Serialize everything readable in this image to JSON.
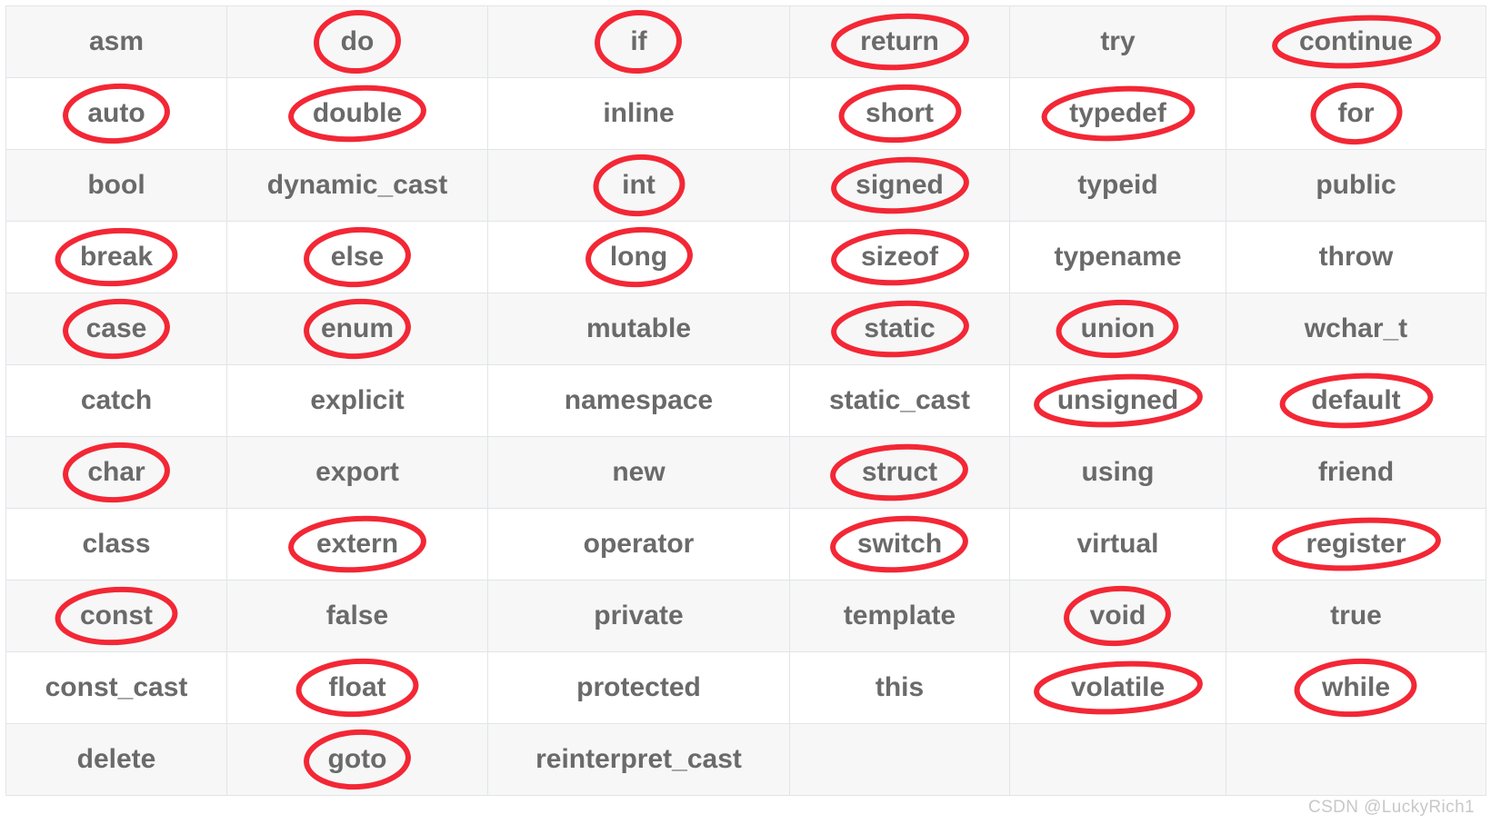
{
  "title": "C++ Keywords Table",
  "colors": {
    "annotation": "#f32735",
    "text": "#6a6a6a",
    "grid": "#e1e4e8",
    "stripe_background": "#f7f7f7",
    "plain_background": "#ffffff",
    "watermark": "#c8c8c8"
  },
  "watermark": "CSDN @LuckyRich1",
  "table": {
    "columns": 6,
    "rows": 11,
    "cells": [
      [
        {
          "text": "asm",
          "circled": false
        },
        {
          "text": "do",
          "circled": true
        },
        {
          "text": "if",
          "circled": true
        },
        {
          "text": "return",
          "circled": true
        },
        {
          "text": "try",
          "circled": false
        },
        {
          "text": "continue",
          "circled": true
        }
      ],
      [
        {
          "text": "auto",
          "circled": true
        },
        {
          "text": "double",
          "circled": true
        },
        {
          "text": "inline",
          "circled": false
        },
        {
          "text": "short",
          "circled": true
        },
        {
          "text": "typedef",
          "circled": true
        },
        {
          "text": "for",
          "circled": true
        }
      ],
      [
        {
          "text": "bool",
          "circled": false
        },
        {
          "text": "dynamic_cast",
          "circled": false
        },
        {
          "text": "int",
          "circled": true
        },
        {
          "text": "signed",
          "circled": true
        },
        {
          "text": "typeid",
          "circled": false
        },
        {
          "text": "public",
          "circled": false
        }
      ],
      [
        {
          "text": "break",
          "circled": true
        },
        {
          "text": "else",
          "circled": true
        },
        {
          "text": "long",
          "circled": true
        },
        {
          "text": "sizeof",
          "circled": true
        },
        {
          "text": "typename",
          "circled": false
        },
        {
          "text": "throw",
          "circled": false
        }
      ],
      [
        {
          "text": "case",
          "circled": true
        },
        {
          "text": "enum",
          "circled": true
        },
        {
          "text": "mutable",
          "circled": false
        },
        {
          "text": "static",
          "circled": true
        },
        {
          "text": "union",
          "circled": true
        },
        {
          "text": "wchar_t",
          "circled": false
        }
      ],
      [
        {
          "text": "catch",
          "circled": false
        },
        {
          "text": "explicit",
          "circled": false
        },
        {
          "text": "namespace",
          "circled": false
        },
        {
          "text": "static_cast",
          "circled": false
        },
        {
          "text": "unsigned",
          "circled": true
        },
        {
          "text": "default",
          "circled": true
        }
      ],
      [
        {
          "text": "char",
          "circled": true
        },
        {
          "text": "export",
          "circled": false
        },
        {
          "text": "new",
          "circled": false
        },
        {
          "text": "struct",
          "circled": true
        },
        {
          "text": "using",
          "circled": false
        },
        {
          "text": "friend",
          "circled": false
        }
      ],
      [
        {
          "text": "class",
          "circled": false
        },
        {
          "text": "extern",
          "circled": true
        },
        {
          "text": "operator",
          "circled": false
        },
        {
          "text": "switch",
          "circled": true
        },
        {
          "text": "virtual",
          "circled": false
        },
        {
          "text": "register",
          "circled": true
        }
      ],
      [
        {
          "text": "const",
          "circled": true
        },
        {
          "text": "false",
          "circled": false
        },
        {
          "text": "private",
          "circled": false
        },
        {
          "text": "template",
          "circled": false
        },
        {
          "text": "void",
          "circled": true
        },
        {
          "text": "true",
          "circled": false
        }
      ],
      [
        {
          "text": "const_cast",
          "circled": false
        },
        {
          "text": "float",
          "circled": true
        },
        {
          "text": "protected",
          "circled": false
        },
        {
          "text": "this",
          "circled": false
        },
        {
          "text": "volatile",
          "circled": true
        },
        {
          "text": "while",
          "circled": true
        }
      ],
      [
        {
          "text": "delete",
          "circled": false
        },
        {
          "text": "goto",
          "circled": true
        },
        {
          "text": "reinterpret_cast",
          "circled": false
        },
        {
          "text": "",
          "circled": false
        },
        {
          "text": "",
          "circled": false
        },
        {
          "text": "",
          "circled": false
        }
      ]
    ]
  }
}
